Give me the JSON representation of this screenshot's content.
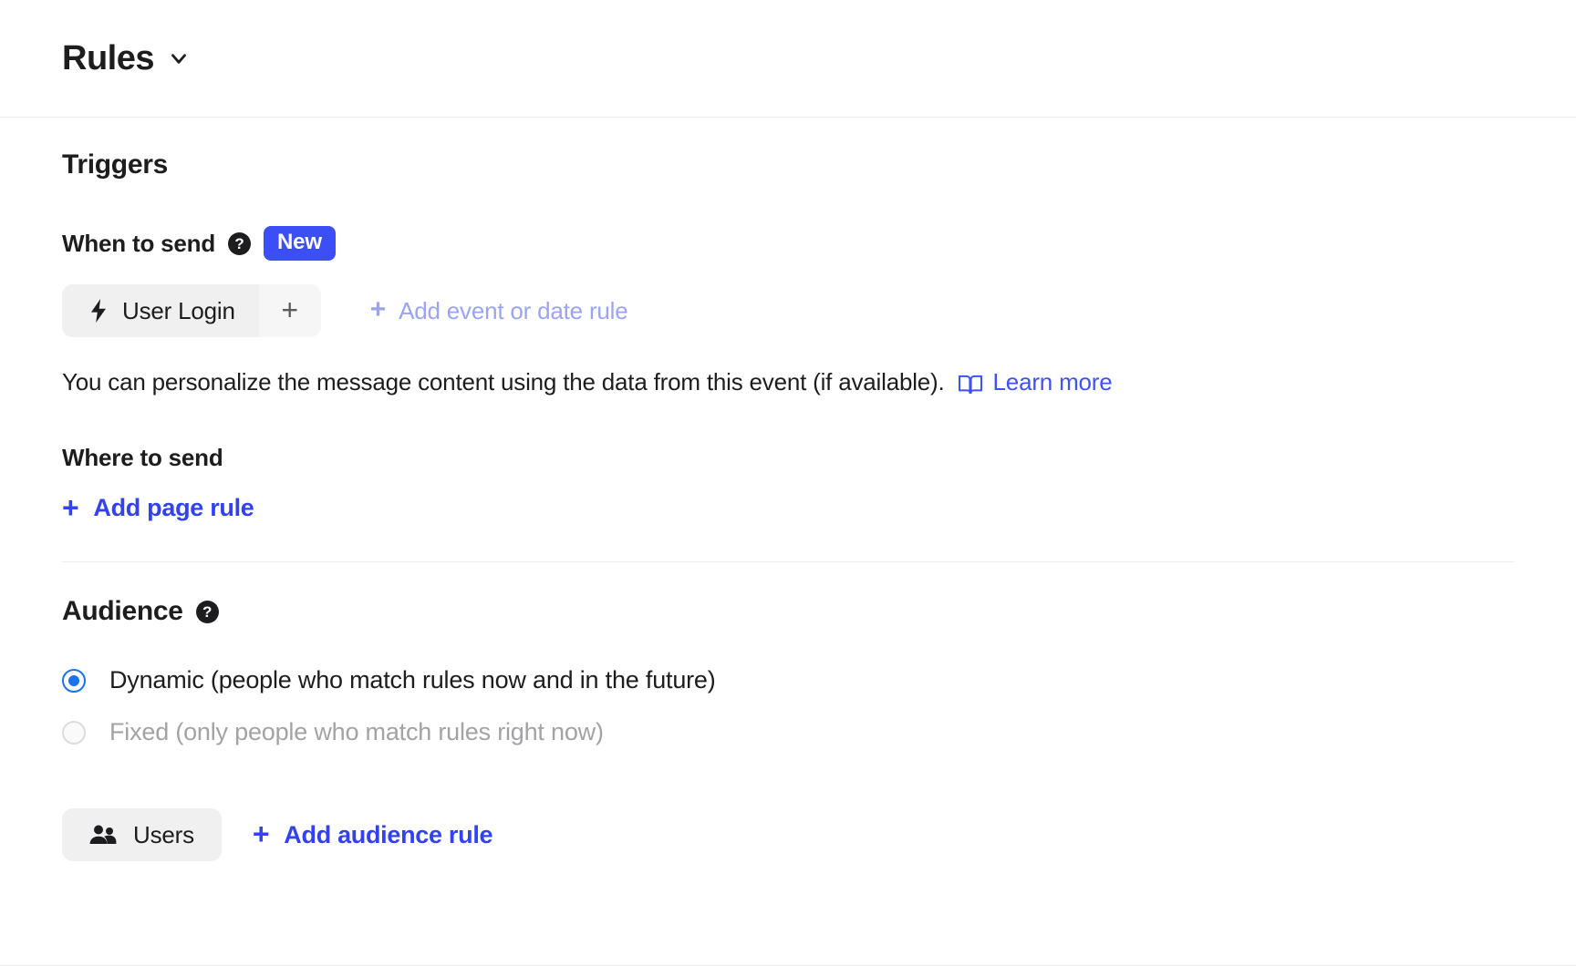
{
  "header": {
    "title": "Rules",
    "chevron_icon": "chevron-down-icon"
  },
  "triggers": {
    "section_title": "Triggers",
    "when_to_send": {
      "label": "When to send",
      "help_icon": "help-circle-icon",
      "badge": "New"
    },
    "event_chip": {
      "icon": "lightning-bolt-icon",
      "label": "User Login",
      "add_glyph": "+"
    },
    "add_event_rule": {
      "plus": "+",
      "label": "Add event or date rule"
    },
    "helper_text_before": "You can personalize the message content using the data from this event (if available).",
    "helper_book_icon": "book-icon",
    "learn_more": "Learn more",
    "where_to_send": {
      "label": "Where to send",
      "add_page_rule": {
        "plus": "+",
        "label": "Add page rule"
      }
    }
  },
  "audience": {
    "section_title": "Audience",
    "help_icon": "help-circle-icon",
    "options": [
      {
        "label": "Dynamic (people who match rules now and in the future)",
        "selected": true,
        "disabled": false
      },
      {
        "label": "Fixed (only people who match rules right now)",
        "selected": false,
        "disabled": true
      }
    ],
    "users_chip": {
      "icon": "users-icon",
      "label": "Users"
    },
    "add_audience_rule": {
      "plus": "+",
      "label": "Add audience rule"
    }
  },
  "colors": {
    "accent_blue": "#3342ef",
    "badge_blue": "#3c4ef5",
    "muted_link": "#9ba4f2",
    "link_blue": "#3f52f5",
    "radio_blue": "#1a73f0",
    "chip_bg": "#f0f0f1",
    "text": "#1d1d1f",
    "dim_text": "#a3a3a7"
  }
}
